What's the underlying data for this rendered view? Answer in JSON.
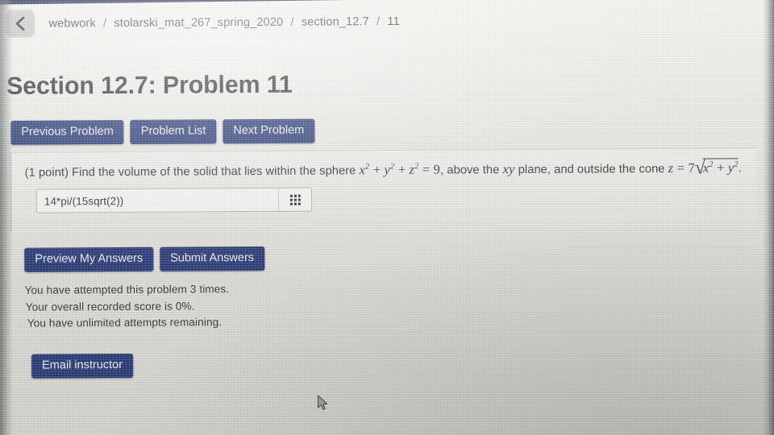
{
  "breadcrumb": {
    "back_icon": "chevron-left-icon",
    "separator": "/",
    "segments": [
      {
        "label": "webwork"
      },
      {
        "label": "stolarski_mat_267_spring_2020"
      },
      {
        "label": "section_12.7"
      },
      {
        "label": "11"
      }
    ]
  },
  "page": {
    "title": "Section 12.7: Problem 11"
  },
  "nav": {
    "previous_problem": "Previous Problem",
    "problem_list": "Problem List",
    "next_problem": "Next Problem"
  },
  "problem": {
    "points": "(1 point)",
    "text_before": "Find the volume of the solid that lies within the sphere",
    "sphere_equation": "x^2 + y^2 + z^2 = 9",
    "text_middle_a": ", above the",
    "plane": "xy",
    "text_middle_b": "plane, and outside the cone",
    "cone_equation": "z = 7 sqrt(x^2 + y^2)",
    "text_end": ".",
    "full_text": "(1 point) Find the volume of the solid that lies within the sphere x^2 + y^2 + z^2 = 9, above the xy plane, and outside the cone z = 7 sqrt(x^2 + y^2)."
  },
  "answer": {
    "value": "14*pi/(15sqrt(2))",
    "placeholder": "",
    "keypad_icon": "grid-keypad-icon"
  },
  "actions": {
    "preview": "Preview My Answers",
    "submit": "Submit Answers",
    "email_instructor": "Email instructor"
  },
  "status": {
    "attempts": "You have attempted this problem 3 times.",
    "score": "Your overall recorded score is 0%.",
    "remaining": "You have unlimited attempts remaining."
  },
  "colors": {
    "button_blue": "#1d2f6e",
    "top_strip": "#141a46",
    "page_background": "#e4e3df",
    "text": "#2b2d30"
  },
  "pointer": {
    "icon": "mouse-cursor-icon"
  }
}
